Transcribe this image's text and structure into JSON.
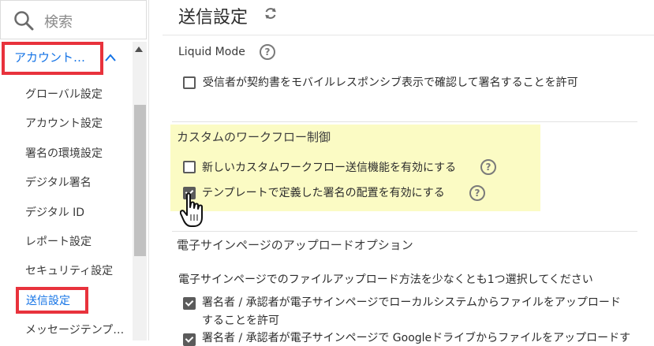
{
  "sidebar": {
    "search_placeholder": "検索",
    "account_label": "アカウント…",
    "items": [
      "グローバル設定",
      "アカウント設定",
      "署名の環境設定",
      "デジタル署名",
      "デジタル ID",
      "レポート設定",
      "セキュリティ設定",
      "送信設定",
      "メッセージテンプ…"
    ]
  },
  "main": {
    "title": "送信設定",
    "liquid": {
      "heading": "Liquid Mode",
      "option": "受信者が契約書をモバイルレスポンシブ表示で確認して署名することを許可"
    },
    "workflow": {
      "heading": "カスタムのワークフロー制御",
      "option1": "新しいカスタムワークフロー送信機能を有効にする",
      "option2": "テンプレートで定義した署名の配置を有効にする"
    },
    "upload": {
      "heading": "電子サインページのアップロードオプション",
      "instruction": "電子サインページでのファイルアップロード方法を少なくとも1つ選択してください",
      "option1_line1": "署名者 / 承認者が電子サインページでローカルシステムからファイルをアップロード",
      "option1_line2": "することを許可",
      "option2_line1": "署名者 / 承認者が電子サインページで Googleドライブからファイルをアップロードす"
    }
  },
  "colors": {
    "accent": "#1473e6",
    "annotation_red": "#e8323c",
    "highlight": "#fbfbc4"
  }
}
